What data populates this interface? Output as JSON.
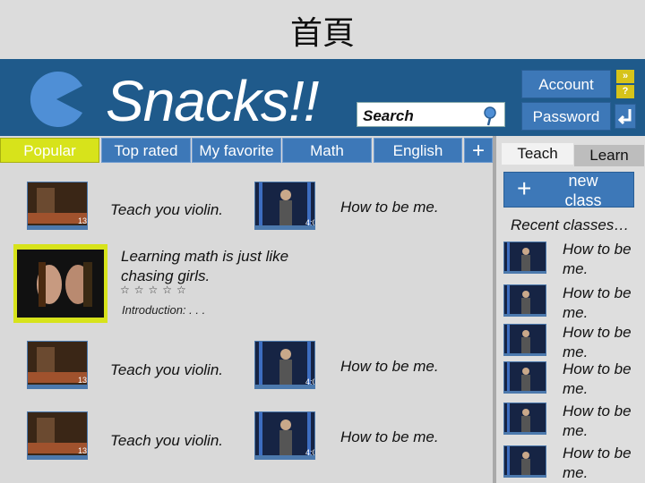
{
  "page_title": "首頁",
  "header": {
    "app_title": "Snacks!!",
    "search_label": "Search",
    "account_label": "Account",
    "password_label": "Password",
    "help_glyph": "?",
    "next_glyph": "»"
  },
  "tabs": [
    {
      "label": "Popular",
      "active": true
    },
    {
      "label": "Top rated",
      "active": false
    },
    {
      "label": "My favorite",
      "active": false
    },
    {
      "label": "Math",
      "active": false
    },
    {
      "label": "English",
      "active": false
    },
    {
      "label": "+",
      "active": false
    }
  ],
  "videos": {
    "row1": {
      "left_title": "Teach you violin.",
      "left_time": "13:",
      "right_title": "How to be me.",
      "right_time": "4:0"
    },
    "featured": {
      "title": "Learning math is just like chasing girls.",
      "stars": "☆☆☆☆☆",
      "intro": "Introduction: . . ."
    },
    "row3": {
      "left_title": "Teach you violin.",
      "left_time": "13:",
      "right_title": "How to be me.",
      "right_time": "4:0"
    },
    "row4": {
      "left_title": "Teach you violin.",
      "left_time": "13:",
      "right_title": "How to be me.",
      "right_time": "4:0"
    }
  },
  "panel": {
    "tab_teach": "Teach",
    "tab_learn": "Learn",
    "new_class_plus": "+",
    "new_class_label": "new class",
    "recent_label": "Recent classes…",
    "recent": [
      {
        "title": "How to be me.",
        "time": "4:0"
      },
      {
        "title": "How to be me.",
        "time": "4:0"
      },
      {
        "title": "How to be me.",
        "time": "4:0"
      },
      {
        "title": "How to be me.",
        "time": "4:0"
      },
      {
        "title": "How to be me.",
        "time": "4:0"
      },
      {
        "title": "How to be me.",
        "time": "4:0"
      }
    ]
  },
  "colors": {
    "header": "#1f5a8b",
    "tab": "#3d78b8",
    "active_tab": "#d7e31b",
    "accent_icon": "#d6c31a"
  }
}
